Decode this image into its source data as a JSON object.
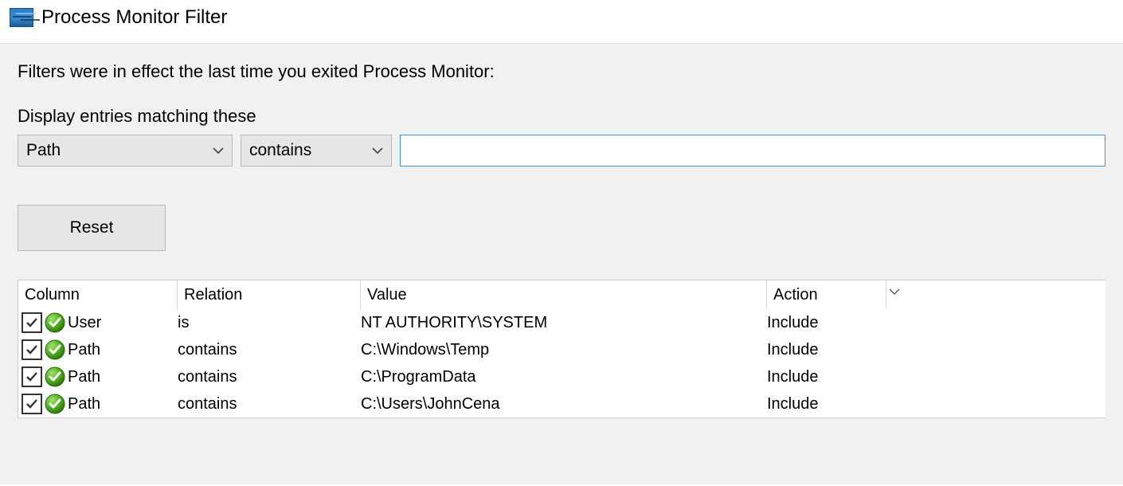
{
  "window": {
    "title": "Process Monitor Filter"
  },
  "content": {
    "status_line": "Filters were in effect the last time you exited Process Monitor:",
    "instruction_line": "Display entries matching these",
    "column_dropdown": {
      "selected": "Path"
    },
    "relation_dropdown": {
      "selected": "contains"
    },
    "value_input": {
      "value": "",
      "placeholder": ""
    },
    "reset_button": "Reset"
  },
  "table": {
    "headers": {
      "column": "Column",
      "relation": "Relation",
      "value": "Value",
      "action": "Action"
    },
    "rows": [
      {
        "checked": true,
        "status": "include",
        "column": "User",
        "relation": "is",
        "value": "NT AUTHORITY\\SYSTEM",
        "action": "Include"
      },
      {
        "checked": true,
        "status": "include",
        "column": "Path",
        "relation": "contains",
        "value": "C:\\Windows\\Temp",
        "action": "Include"
      },
      {
        "checked": true,
        "status": "include",
        "column": "Path",
        "relation": "contains",
        "value": "C:\\ProgramData",
        "action": "Include"
      },
      {
        "checked": true,
        "status": "include",
        "column": "Path",
        "relation": "contains",
        "value": "C:\\Users\\JohnCena",
        "action": "Include"
      }
    ]
  }
}
